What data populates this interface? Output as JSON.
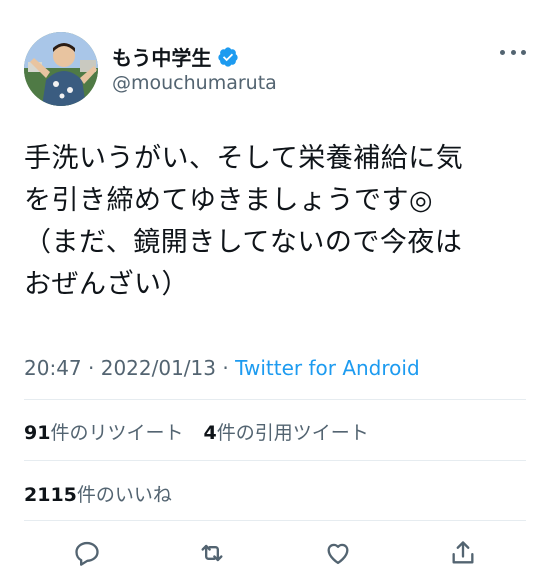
{
  "user": {
    "display_name": "もう中学生",
    "handle": "@mouchumaruta",
    "avatar_icon": "avatar-photo",
    "verified_icon": "verified-badge-icon"
  },
  "tweet": {
    "text": "手洗いうがい、そして栄養補給に気\nを引き締めてゆきましょうです◎\n（まだ、鏡開きしてないので今夜は\nおぜんざい）",
    "time": "20:47",
    "date": "2022/01/13",
    "separator": "·",
    "source": "Twitter for Android"
  },
  "stats": {
    "retweets_count": "91",
    "retweets_label": "件のリツイート",
    "quotes_count": "4",
    "quotes_label": "件の引用ツイート",
    "likes_count": "2115",
    "likes_label": "件のいいね"
  },
  "actions": [
    {
      "icon": "reply-icon"
    },
    {
      "icon": "retweet-icon"
    },
    {
      "icon": "like-icon"
    },
    {
      "icon": "share-icon"
    }
  ],
  "colors": {
    "link": "#1d9bf0",
    "verified": "#1d9bf0",
    "secondary_text": "#536471",
    "divider": "#e6ecf0"
  }
}
